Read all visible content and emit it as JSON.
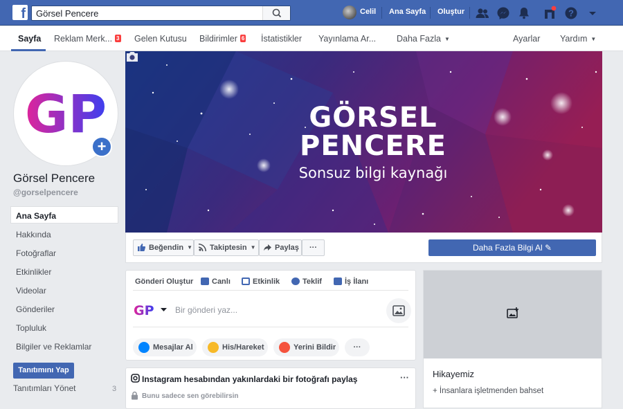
{
  "topbar": {
    "search_value": "Görsel Pencere",
    "user_name": "Celil",
    "home_label": "Ana Sayfa",
    "create_label": "Oluştur"
  },
  "page_nav": {
    "items": [
      {
        "label": "Sayfa"
      },
      {
        "label": "Reklam Merk...",
        "badge": "3"
      },
      {
        "label": "Gelen Kutusu"
      },
      {
        "label": "Bildirimler",
        "badge": "6"
      },
      {
        "label": "İstatistikler"
      },
      {
        "label": "Yayınlama Ar..."
      },
      {
        "label": "Daha Fazla"
      }
    ],
    "settings_label": "Ayarlar",
    "help_label": "Yardım"
  },
  "profile": {
    "initials": "GP",
    "name": "Görsel Pencere",
    "handle": "@gorselpencere"
  },
  "left_nav": {
    "items": [
      "Ana Sayfa",
      "Hakkında",
      "Fotoğraflar",
      "Etkinlikler",
      "Videolar",
      "Gönderiler",
      "Topluluk",
      "Bilgiler ve Reklamlar"
    ],
    "promote_label": "Tanıtımını Yap",
    "manage_promotions_label": "Tanıtımları Yönet",
    "manage_promotions_count": "3"
  },
  "cover": {
    "title_line1": "GÖRSEL",
    "title_line2": "PENCERE",
    "subtitle": "Sonsuz bilgi kaynağı"
  },
  "actions": {
    "like_label": "Beğendin",
    "follow_label": "Takiptesin",
    "share_label": "Paylaş",
    "more_label": "···",
    "learn_more_label": "Daha Fazla Bilgi Al"
  },
  "composer": {
    "tabs": [
      "Gönderi Oluştur",
      "Canlı",
      "Etkinlik",
      "Teklif",
      "İş İlanı"
    ],
    "placeholder": "Bir gönderi yaz...",
    "chips": [
      "Mesajlar Al",
      "His/Hareket",
      "Yerini Bildir"
    ],
    "more_label": "···"
  },
  "instagram": {
    "title": "Instagram hesabından yakınlardaki bir fotoğrafı paylaş",
    "privacy_note": "Bunu sadece sen görebilirsin",
    "more_label": "···"
  },
  "story": {
    "title": "Hikayemiz",
    "cta": "+ İnsanlara işletmenden bahset"
  },
  "colors": {
    "brand_blue": "#4267b2",
    "badge_red": "#fa3e3e",
    "gp_gradient_start": "#e0249a",
    "gp_gradient_end": "#3c3ff0"
  }
}
